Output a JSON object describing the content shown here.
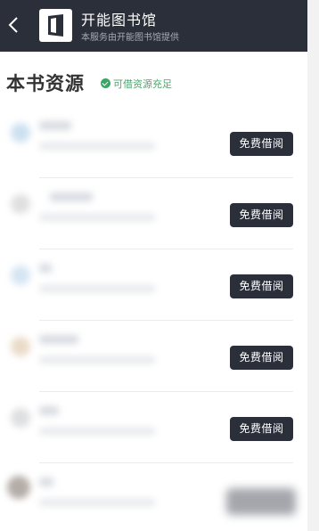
{
  "header": {
    "title": "开能图书馆",
    "subtitle": "本服务由开能图书馆提供",
    "back_icon": "chevron-left-icon",
    "logo_icon": "door-logo-icon"
  },
  "section": {
    "title": "本书资源",
    "status_text": "可借资源充足",
    "status_icon": "check-circle-icon"
  },
  "rows": [
    {
      "button_label": "免费借阅",
      "avatar_color": "#bcd6ec"
    },
    {
      "button_label": "免费借阅",
      "avatar_color": "#d5d5d5"
    },
    {
      "button_label": "免费借阅",
      "avatar_color": "#c7dcee"
    },
    {
      "button_label": "免费借阅",
      "avatar_color": "#e3cfb6"
    },
    {
      "button_label": "免费借阅",
      "avatar_color": "#d3d4d7"
    },
    {
      "button_label": "",
      "avatar_color": "#9b918a"
    }
  ],
  "colors": {
    "bar": "#2b2f3a",
    "button": "#2b2f3a",
    "status": "#3da467"
  }
}
